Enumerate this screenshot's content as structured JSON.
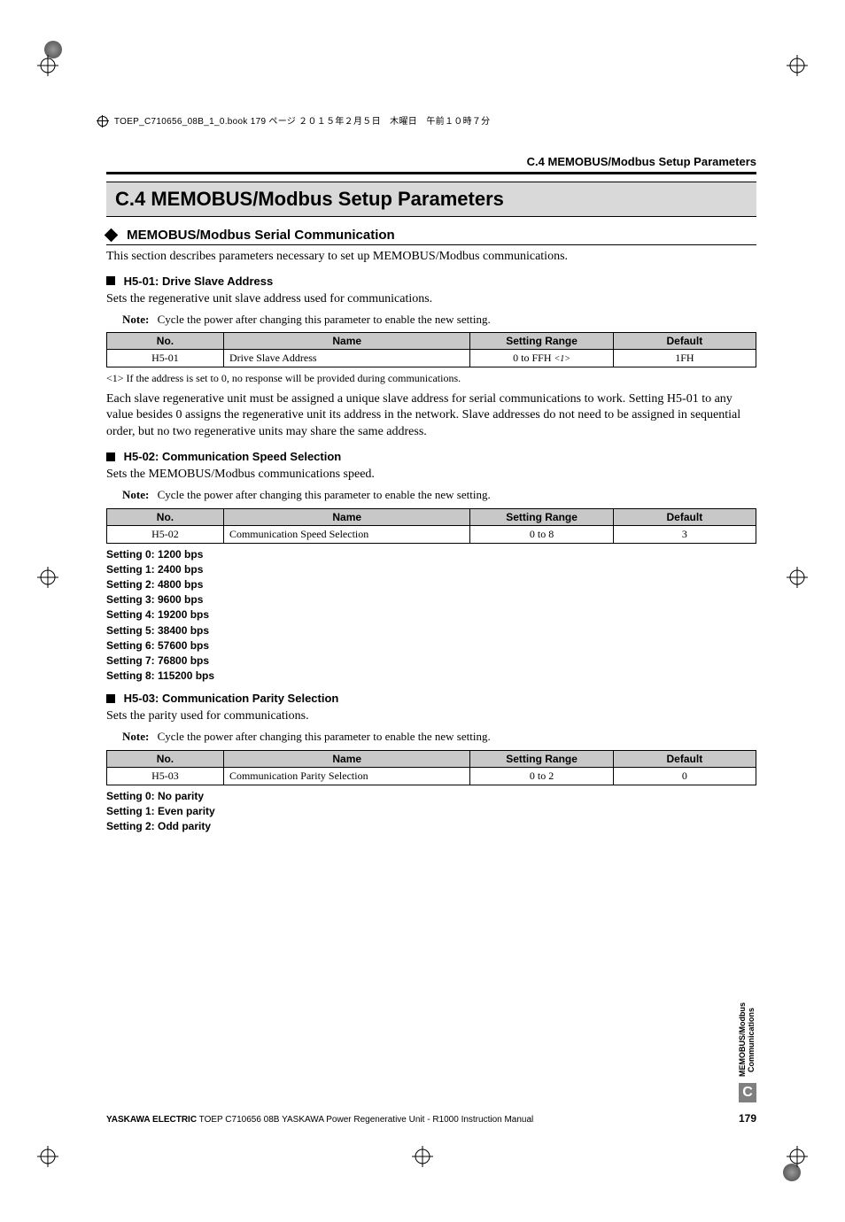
{
  "crop_header": "TOEP_C710656_08B_1_0.book  179 ページ  ２０１５年２月５日　木曜日　午前１０時７分",
  "running_head": "C.4  MEMOBUS/Modbus Setup Parameters",
  "title": "C.4   MEMOBUS/Modbus Setup Parameters",
  "sub_serial": "MEMOBUS/Modbus Serial Communication",
  "intro": "This section describes parameters necessary to set up MEMOBUS/Modbus communications.",
  "h5_01": {
    "heading": "H5-01: Drive Slave Address",
    "desc": "Sets the regenerative unit slave address used for communications.",
    "note_label": "Note:",
    "note": "Cycle the power after changing this parameter to enable the new setting.",
    "table": {
      "no": "H5-01",
      "name": "Drive Slave Address",
      "range": "0 to FFH",
      "range_ref": "<1>",
      "def": "1FH"
    },
    "footnote": "<1> If the address is set to 0, no response will be provided during communications.",
    "para": "Each slave regenerative unit must be assigned a unique slave address for serial communications to work. Setting H5-01 to any value besides 0 assigns the regenerative unit its address in the network. Slave addresses do not need to be assigned in sequential order, but no two regenerative units may share the same address."
  },
  "h5_02": {
    "heading": "H5-02: Communication Speed Selection",
    "desc": "Sets the MEMOBUS/Modbus communications speed.",
    "note_label": "Note:",
    "note": "Cycle the power after changing this parameter to enable the new setting.",
    "table": {
      "no": "H5-02",
      "name": "Communication Speed Selection",
      "range": "0 to 8",
      "def": "3"
    },
    "settings": [
      "Setting 0: 1200 bps",
      "Setting 1: 2400 bps",
      "Setting 2: 4800 bps",
      "Setting 3: 9600 bps",
      "Setting 4: 19200 bps",
      "Setting 5: 38400 bps",
      "Setting 6: 57600 bps",
      "Setting 7: 76800 bps",
      "Setting 8: 115200 bps"
    ]
  },
  "h5_03": {
    "heading": "H5-03: Communication Parity Selection",
    "desc": "Sets the parity used for communications.",
    "note_label": "Note:",
    "note": "Cycle the power after changing this parameter to enable the new setting.",
    "table": {
      "no": "H5-03",
      "name": "Communication Parity Selection",
      "range": "0 to 2",
      "def": "0"
    },
    "settings": [
      "Setting 0: No parity",
      "Setting 1: Even parity",
      "Setting 2: Odd parity"
    ]
  },
  "table_headers": {
    "no": "No.",
    "name": "Name",
    "range": "Setting Range",
    "def": "Default"
  },
  "side_tab": {
    "line1": "MEMOBUS/Modbus",
    "line2": "Communications",
    "letter": "C"
  },
  "footer": {
    "left_bold": "YASKAWA ELECTRIC",
    "left_rest": " TOEP C710656 08B YASKAWA Power Regenerative Unit - R1000 Instruction Manual",
    "page": "179"
  }
}
